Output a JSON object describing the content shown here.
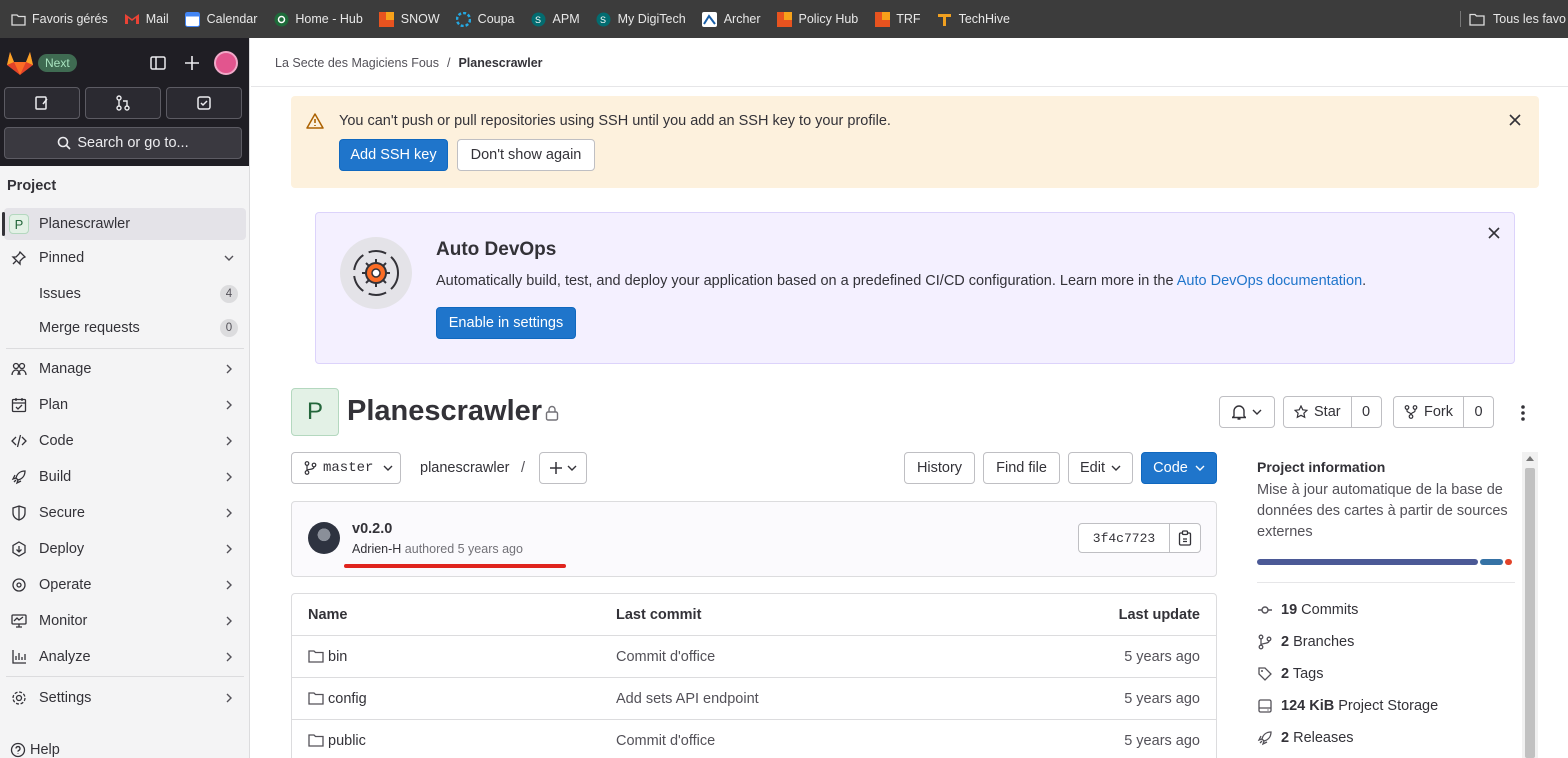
{
  "bookmarks": {
    "items": [
      {
        "label": "Favoris gérés",
        "icon": "managed-bookmarks-icon"
      },
      {
        "label": "Mail",
        "icon": "gmail-icon"
      },
      {
        "label": "Calendar",
        "icon": "calendar-icon"
      },
      {
        "label": "Home - Hub",
        "icon": "hub-icon"
      },
      {
        "label": "SNOW",
        "icon": "snow-icon"
      },
      {
        "label": "Coupa",
        "icon": "coupa-icon"
      },
      {
        "label": "APM",
        "icon": "sharepoint-icon"
      },
      {
        "label": "My DigiTech",
        "icon": "sharepoint-icon"
      },
      {
        "label": "Archer",
        "icon": "archer-icon"
      },
      {
        "label": "Policy Hub",
        "icon": "policy-hub-icon"
      },
      {
        "label": "TRF",
        "icon": "trf-icon"
      },
      {
        "label": "TechHive",
        "icon": "techhive-icon"
      }
    ],
    "all_label": "Tous les favo"
  },
  "sidebar": {
    "next_badge": "Next",
    "search_label": "Search or go to...",
    "section": "Project",
    "project_letter": "P",
    "project_name": "Planescrawler",
    "pinned": "Pinned",
    "pinned_items": [
      {
        "label": "Issues",
        "count": "4"
      },
      {
        "label": "Merge requests",
        "count": "0"
      }
    ],
    "nav": [
      "Manage",
      "Plan",
      "Code",
      "Build",
      "Secure",
      "Deploy",
      "Operate",
      "Monitor",
      "Analyze"
    ],
    "settings": "Settings",
    "help": "Help"
  },
  "breadcrumb": {
    "group": "La Secte des Magiciens Fous",
    "separator": "/",
    "project": "Planescrawler"
  },
  "ssh_alert": {
    "message": "You can't push or pull repositories using SSH until you add an SSH key to your profile.",
    "primary": "Add SSH key",
    "secondary": "Don't show again"
  },
  "devops": {
    "title": "Auto DevOps",
    "text": "Automatically build, test, and deploy your application based on a predefined CI/CD configuration. Learn more in the ",
    "link": "Auto DevOps documentation",
    "suffix": ".",
    "button": "Enable in settings"
  },
  "project": {
    "letter": "P",
    "title": "Planescrawler",
    "star_label": "Star",
    "star_count": "0",
    "fork_label": "Fork",
    "fork_count": "0"
  },
  "repo": {
    "branch": "master",
    "path": "planescrawler",
    "path_sep": "/",
    "history": "History",
    "find_file": "Find file",
    "edit": "Edit",
    "code": "Code"
  },
  "commit": {
    "title": "v0.2.0",
    "author": "Adrien-H",
    "meta": " authored 5 years ago",
    "sha": "3f4c7723"
  },
  "files": {
    "headers": {
      "name": "Name",
      "last_commit": "Last commit",
      "last_update": "Last update"
    },
    "rows": [
      {
        "name": "bin",
        "commit": "Commit d'office",
        "updated": "5 years ago"
      },
      {
        "name": "config",
        "commit": "Add sets API endpoint",
        "updated": "5 years ago"
      },
      {
        "name": "public",
        "commit": "Commit d'office",
        "updated": "5 years ago"
      }
    ]
  },
  "project_info": {
    "title": "Project information",
    "description": "Mise à jour automatique de la base de données des cartes à partir de sources externes",
    "language_colors": [
      "#4b5996",
      "#3572a5",
      "#e24329"
    ],
    "language_shares": [
      0.87,
      0.09,
      0.03
    ],
    "stats": [
      {
        "value": "19",
        "label": "Commits",
        "icon": "commit-icon"
      },
      {
        "value": "2",
        "label": "Branches",
        "icon": "branch-icon"
      },
      {
        "value": "2",
        "label": "Tags",
        "icon": "label-icon"
      },
      {
        "value": "124 KiB",
        "label": "Project Storage",
        "icon": "disk-icon"
      },
      {
        "value": "2",
        "label": "Releases",
        "icon": "rocket-icon"
      }
    ]
  },
  "colors": {
    "primary": "#1f75cb",
    "sidebar_dark": "#1f1e24",
    "alert_bg": "#fdf1dd",
    "devops_bg": "#f4f0ff",
    "annotation_red": "#e0241e"
  }
}
